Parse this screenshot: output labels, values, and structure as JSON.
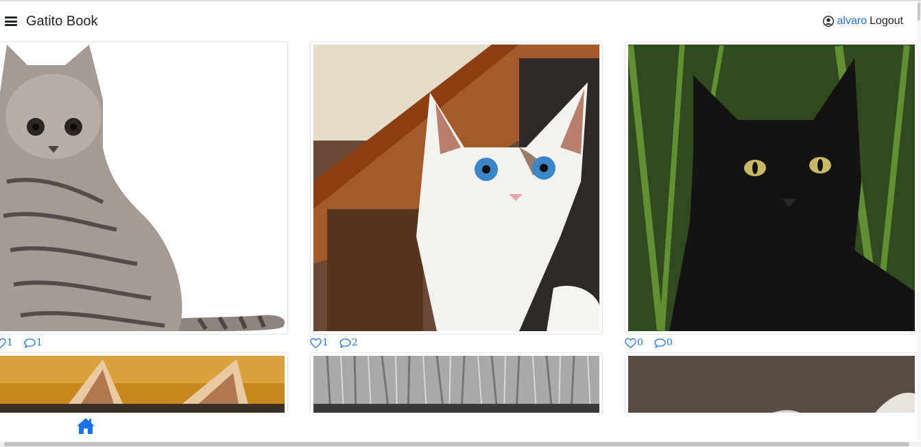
{
  "navbar": {
    "menu_icon": "hamburger-icon",
    "brand": "Gatito Book",
    "user_icon": "user-circle-icon",
    "username": "alvaro",
    "logout_label": "Logout"
  },
  "photos": [
    {
      "subject": "tabby-cat",
      "likes": "1",
      "comments": "1"
    },
    {
      "subject": "white-blue-eyed-kitten",
      "likes": "1",
      "comments": "2"
    },
    {
      "subject": "black-cat",
      "likes": "0",
      "comments": "0"
    },
    {
      "subject": "orange-cat-ears"
    },
    {
      "subject": "grey-fur"
    },
    {
      "subject": "dark-cat"
    }
  ],
  "footer": {
    "home_icon": "home-icon"
  },
  "colors": {
    "link": "#1a73e8",
    "text": "#212529",
    "border": "#e3e3e3"
  }
}
